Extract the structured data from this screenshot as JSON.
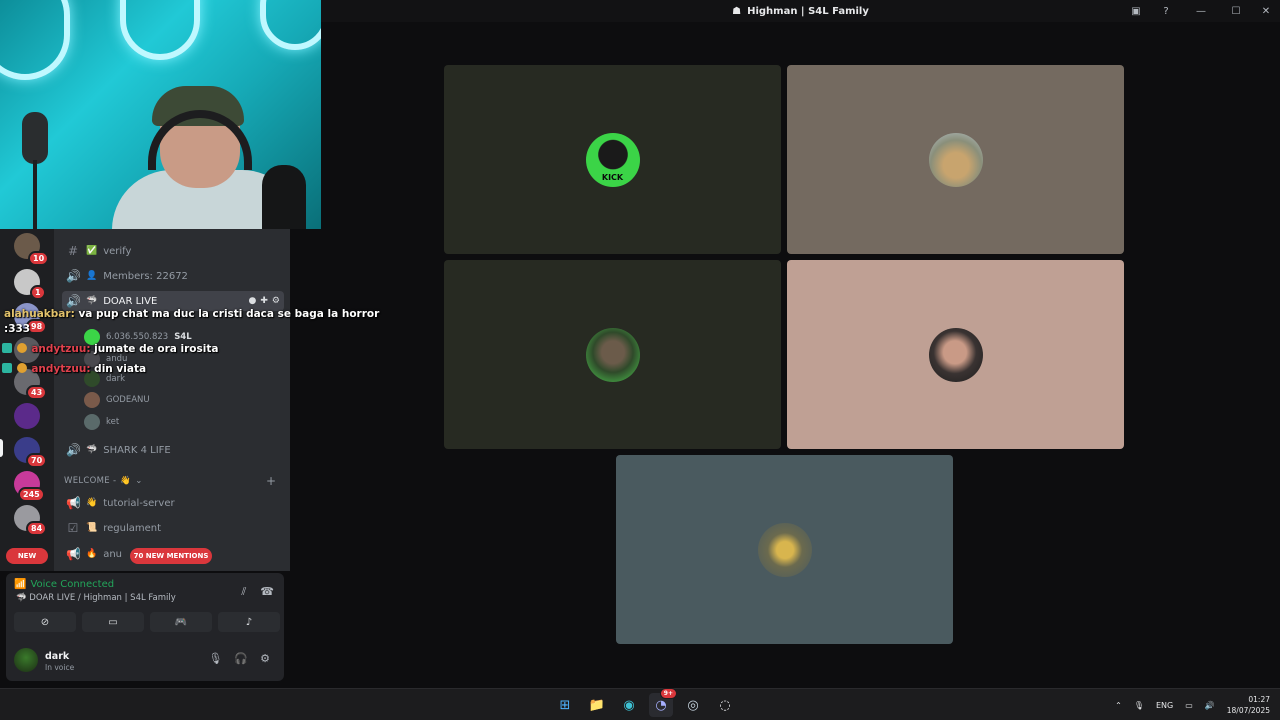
{
  "window": {
    "title": "Highman | S4L Family"
  },
  "server_rail": {
    "badges": [
      "10",
      "1",
      "98",
      "43",
      "70",
      "245",
      "84"
    ],
    "new_label": "NEW"
  },
  "channels": {
    "verify": "verify",
    "members": "Members: 22672",
    "doar_live": "DOAR LIVE",
    "voice_users": [
      {
        "name": "6.036.550.823",
        "tag": "S4L"
      },
      {
        "name": "andu",
        "tag": ""
      },
      {
        "name": "dark",
        "tag": ""
      },
      {
        "name": "GODEANU",
        "tag": ""
      },
      {
        "name": "ket",
        "tag": ""
      }
    ],
    "shark": "SHARK 4 LIFE",
    "category": "WELCOME -",
    "tutorial": "tutorial-server",
    "regulament": "regulament",
    "anunturi": "anu",
    "mentions_pill": "70 NEW MENTIONS"
  },
  "chat": [
    {
      "user": "alahuakbar:",
      "text": "va pup chat ma duc la cristi daca se baga la horror",
      "user_color": "#e2c26b"
    },
    {
      "user": "",
      "text": ":333",
      "user_color": "#e2c26b"
    },
    {
      "user": "andytzuu:",
      "text": "jumate de ora irosita",
      "user_color": "#e0414d"
    },
    {
      "user": "andytzuu:",
      "text": "din viata",
      "user_color": "#e0414d"
    }
  ],
  "voice_panel": {
    "status": "Voice Connected",
    "channel": "DOAR LIVE / Highman | S4L Family"
  },
  "user_panel": {
    "name": "dark",
    "status": "In voice"
  },
  "tiles": [
    {
      "bg": "#272a22",
      "avatar": "#3bd447"
    },
    {
      "bg": "#746a60",
      "avatar": "#b89a6a"
    },
    {
      "bg": "#272a22",
      "avatar": "#2f4a2a"
    },
    {
      "bg": "#bfa094",
      "avatar": "#3a3332"
    },
    {
      "bg": "#4a5a5f",
      "avatar": "#8c7a46"
    }
  ],
  "tile_labels": {
    "kick": "KICK"
  },
  "taskbar": {
    "lang": "ENG",
    "time": "01:27",
    "date": "18/07/2025",
    "discord_badge": "9+"
  }
}
